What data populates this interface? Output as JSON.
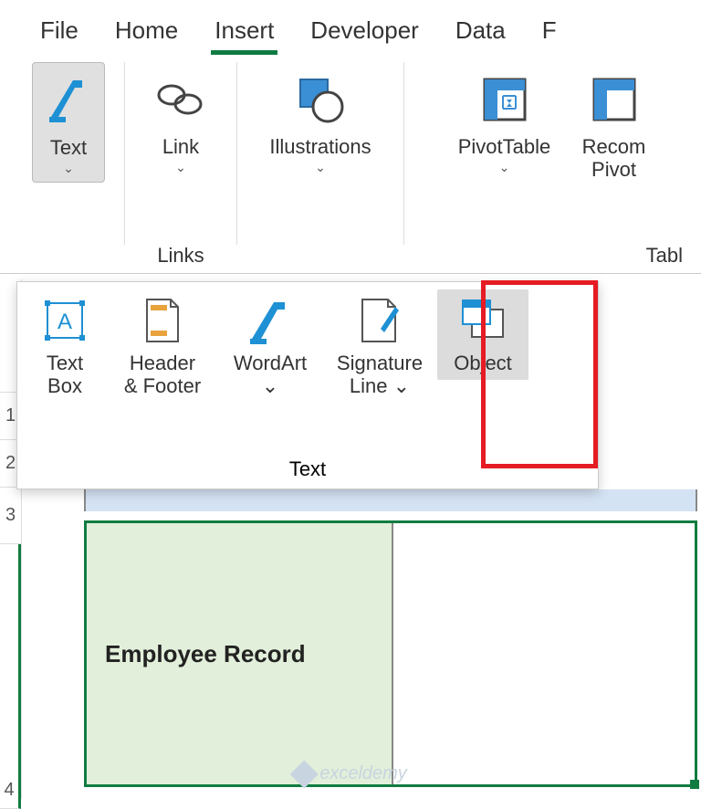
{
  "tabs": {
    "file": "File",
    "home": "Home",
    "insert": "Insert",
    "developer": "Developer",
    "data": "Data",
    "partial": "F"
  },
  "ribbon": {
    "text": {
      "label": "Text"
    },
    "link": {
      "label": "Link",
      "group": "Links"
    },
    "illustrations": {
      "label": "Illustrations"
    },
    "pivot": {
      "label": "PivotTable"
    },
    "recom": {
      "line1": "Recom",
      "line2": "Pivot",
      "group": "Tabl"
    }
  },
  "dropdown": {
    "textbox": {
      "line1": "Text",
      "line2": "Box"
    },
    "header": {
      "line1": "Header",
      "line2": "& Footer"
    },
    "wordart": {
      "line1": "WordArt",
      "chev": "⌄"
    },
    "sig": {
      "line1": "Signature",
      "line2": "Line ⌄"
    },
    "object": {
      "label": "Object"
    },
    "group": "Text"
  },
  "rows": {
    "r1": "1",
    "r2": "2",
    "r3": "3",
    "r4": "4"
  },
  "cell": {
    "b4": "Employee Record"
  },
  "watermark": "exceldemy"
}
